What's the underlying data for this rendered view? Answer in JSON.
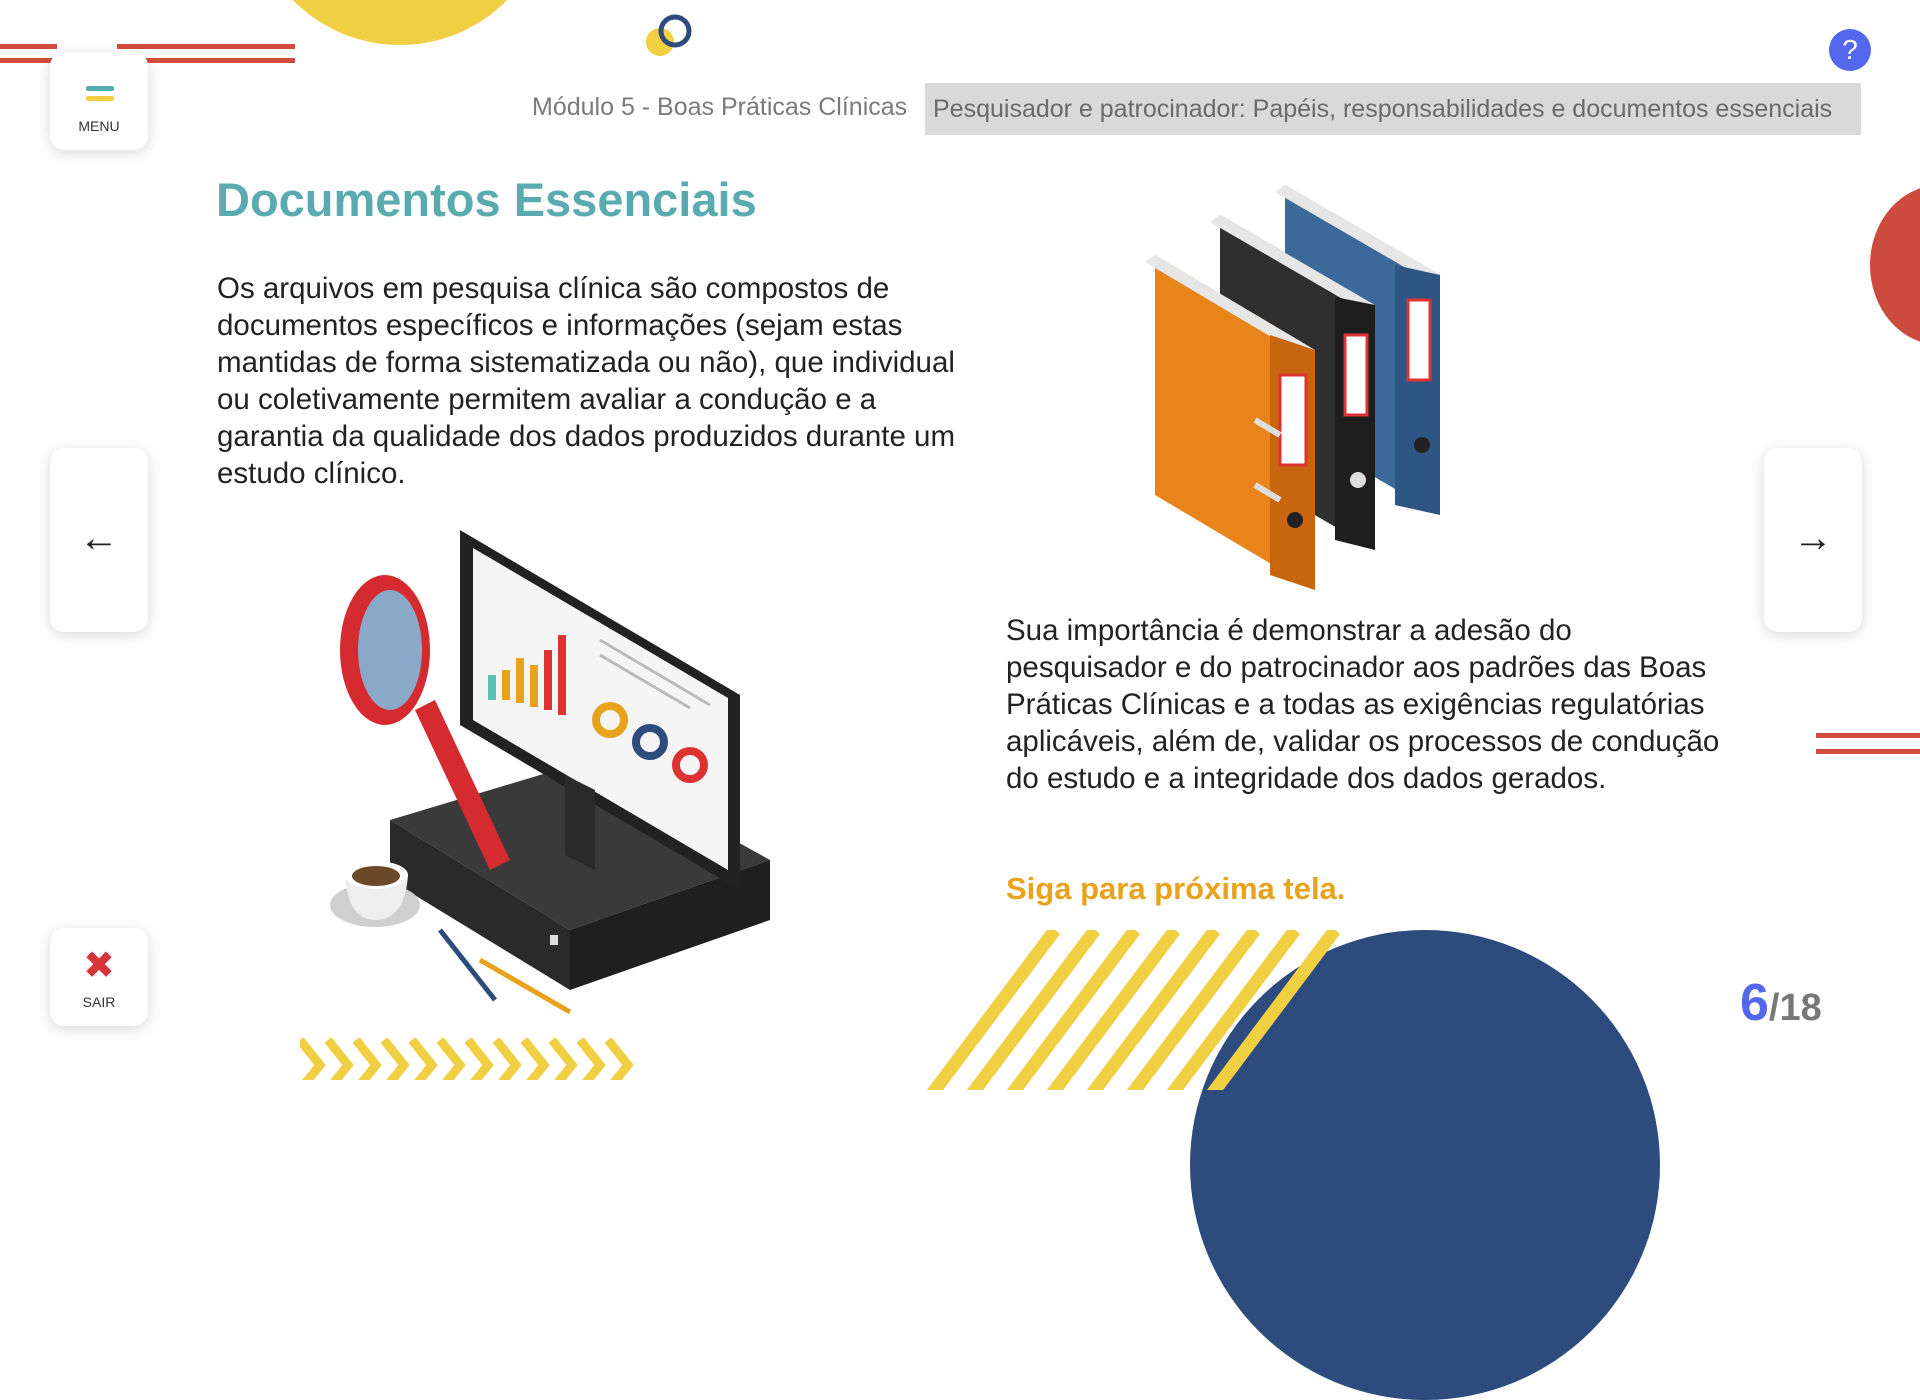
{
  "header": {
    "module_title": "Módulo 5 - Boas Práticas Clínicas",
    "topic": "Pesquisador e patrocinador: Papéis, responsabilidades e documentos essenciais"
  },
  "menu": {
    "label": "MENU",
    "icon": "hamburger-icon"
  },
  "exit": {
    "label": "SAIR",
    "icon": "close-icon",
    "glyph": "✖"
  },
  "help": {
    "label": "?",
    "icon": "help-icon"
  },
  "nav": {
    "prev_glyph": "←",
    "next_glyph": "→"
  },
  "content": {
    "title": "Documentos Essenciais",
    "paragraph_1": "Os arquivos em pesquisa clínica são compostos de documentos específicos e informações (sejam estas mantidas de forma sistematizada ou não), que individual ou coletivamente permitem avaliar a condução e a garantia da qualidade dos dados produzidos durante um estudo clínico.",
    "paragraph_2": "Sua importância é demonstrar a adesão do pesquisador e do patrocinador aos padrões das Boas Práticas Clínicas e a todas as exigências regulatórias aplicáveis, além de, validar os processos de condução do estudo e a integridade dos dados gerados.",
    "cta": "Siga para próxima tela."
  },
  "pagination": {
    "current": "6",
    "total": "/18"
  },
  "colors": {
    "accent_teal": "#5aabaf",
    "accent_orange": "#e8a21c",
    "accent_blue": "#5468ee",
    "deco_yellow": "#f0cf43",
    "deco_red": "#d24d3e",
    "deco_navy": "#2d4b7c"
  }
}
